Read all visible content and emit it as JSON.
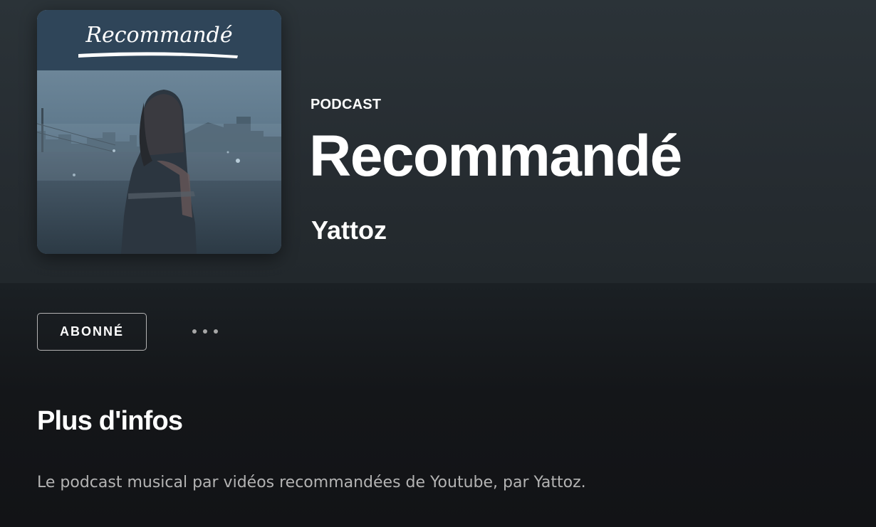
{
  "header": {
    "cover_banner_text": "Recommandé",
    "type_label": "PODCAST",
    "title": "Recommandé",
    "author": "Yattoz"
  },
  "actions": {
    "follow_label": "ABONNÉ",
    "more_icon": "more-options-icon"
  },
  "about": {
    "heading": "Plus d'infos",
    "description": "Le podcast musical par vidéos recommandées de Youtube, par Yattoz."
  },
  "colors": {
    "background": "#121417",
    "hero_background": "#2b3338",
    "text_primary": "#ffffff",
    "text_secondary": "#b3b3b3",
    "cover_banner": "#2f4559"
  }
}
